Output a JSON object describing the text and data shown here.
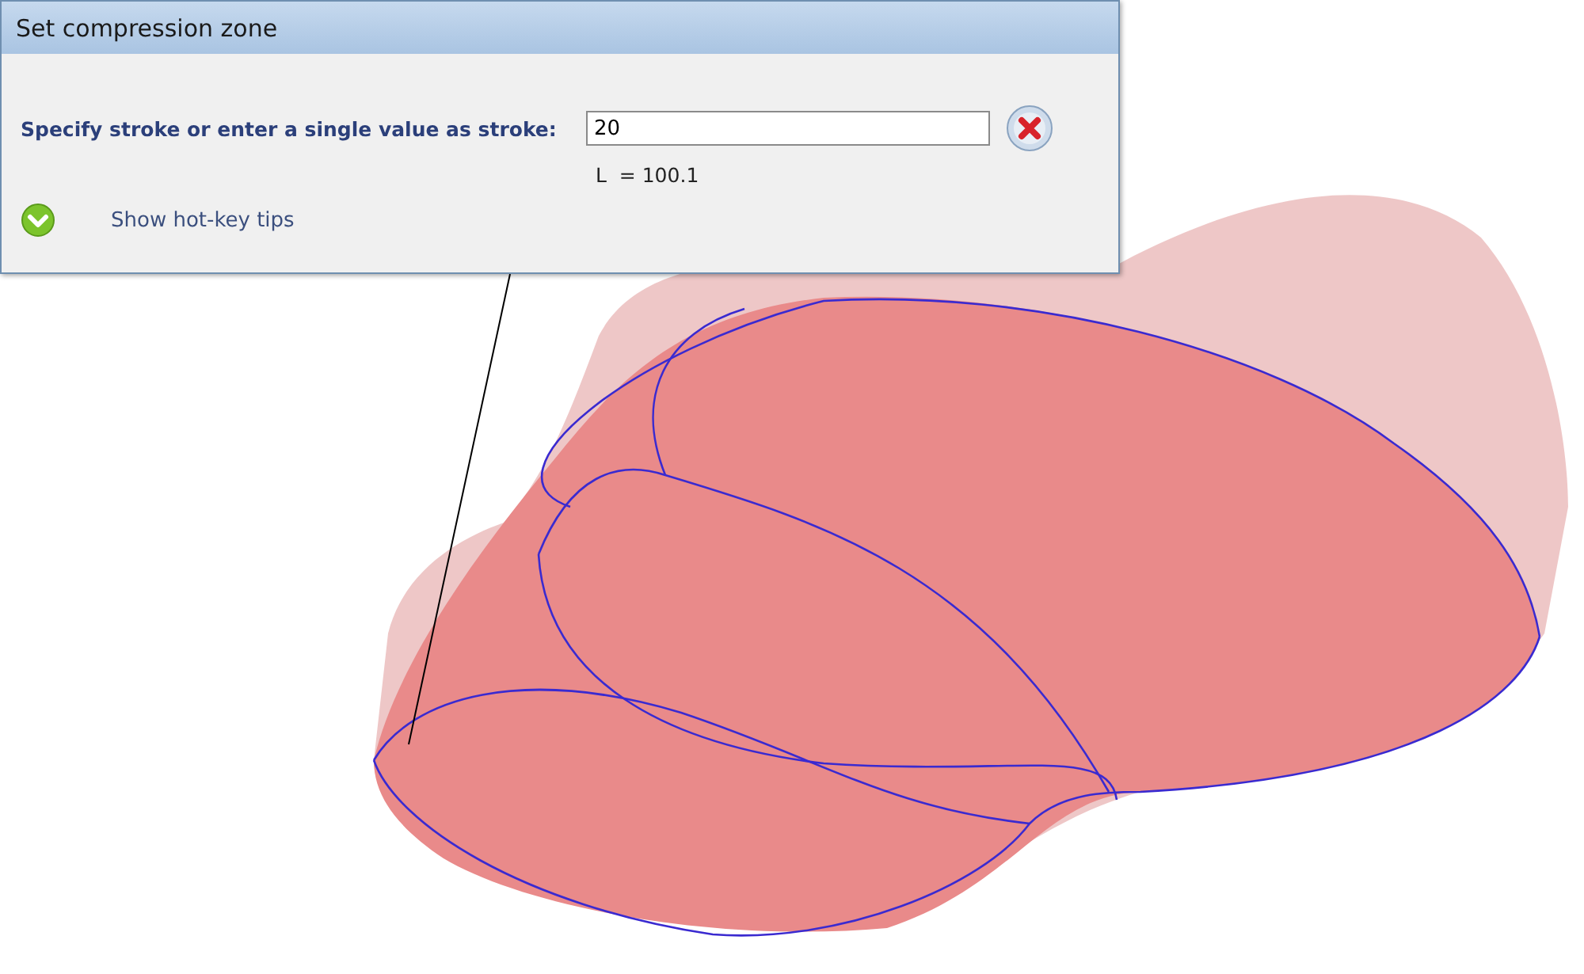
{
  "dialog": {
    "title": "Set compression zone",
    "prompt": "Specify stroke or enter a single value as stroke:",
    "stroke_value": "20",
    "length_reading": "L  = 100.1",
    "hotkey_link": "Show hot-key tips"
  }
}
